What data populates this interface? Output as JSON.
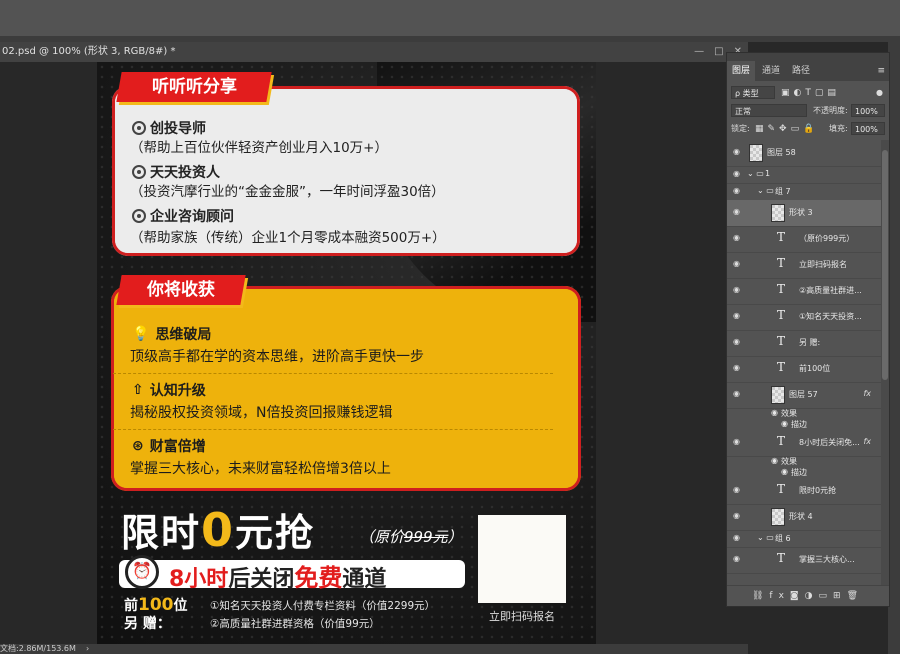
{
  "document": {
    "tab_title": "02.psd @ 100% (形状 3, RGB/8#) *",
    "status": {
      "doc_size": "文档:2.86M/153.6M"
    }
  },
  "poster": {
    "share_tag": "听听听分享",
    "share_items": [
      {
        "title": "创投导师",
        "desc": "（帮助上百位伙伴轻资产创业月入10万+）"
      },
      {
        "title": "天天投资人",
        "desc": "（投资汽摩行业的“金金金服”，一年时间浮盈30倍）"
      },
      {
        "title": "企业咨询顾问",
        "desc": "（帮助家族（传统）企业1个月零成本融资500万+）"
      }
    ],
    "gain_tag": "你将收获",
    "gain_items": [
      {
        "icon": "lightbulb-icon",
        "glyph": "💡",
        "title": "思维破局",
        "desc": "顶级高手都在学的资本思维，进阶高手更快一步"
      },
      {
        "icon": "arrow-up-icon",
        "glyph": "⇧",
        "title": "认知升级",
        "desc": "揭秘股权投资领域，N倍投资回报赚钱逻辑"
      },
      {
        "icon": "money-icon",
        "glyph": "⊛",
        "title": "财富倍增",
        "desc": "掌握三大核心，未来财富轻松倍增3倍以上"
      }
    ],
    "promo": {
      "part1": "限时",
      "zero": "0",
      "part2": "元抢"
    },
    "original_price": {
      "prefix": "（原价",
      "value": "999元",
      "suffix": "）"
    },
    "countdown": {
      "hours": "8小时",
      "middle": "后关闭",
      "free": "免费",
      "end": "通道"
    },
    "first100": {
      "line1_a": "前",
      "line1_num": "100",
      "line1_b": "位",
      "line2": "另    赠："
    },
    "bonuses": [
      "①知名天天投资人付费专栏资料（价值2299元）",
      "②高质量社群进群资格（价值99元）"
    ],
    "qr_label": "立即扫码报名"
  },
  "layers_panel": {
    "tabs": [
      "图层",
      "通道",
      "路径"
    ],
    "filter_kind": "ρ 类型",
    "blend_mode": "正常",
    "opacity_label": "不透明度:",
    "opacity": "100%",
    "lock_label": "锁定:",
    "fill_label": "填充:",
    "fill": "100%",
    "layers": [
      {
        "name": "图层 58",
        "kind": "image",
        "indent": 0
      },
      {
        "name": "1",
        "kind": "group",
        "indent": 0
      },
      {
        "name": "组 7",
        "kind": "group",
        "indent": 1
      },
      {
        "name": "形状 3",
        "kind": "shape",
        "indent": 2,
        "selected": true
      },
      {
        "name": "（原价999元）",
        "kind": "text",
        "indent": 2
      },
      {
        "name": "立即扫码报名",
        "kind": "text",
        "indent": 2
      },
      {
        "name": "②高质量社群进...",
        "kind": "text",
        "indent": 2
      },
      {
        "name": "①知名天天投资...",
        "kind": "text",
        "indent": 2
      },
      {
        "name": "另    赠:",
        "kind": "text",
        "indent": 2
      },
      {
        "name": "前100位",
        "kind": "text",
        "indent": 2
      },
      {
        "name": "图层 57",
        "kind": "image",
        "indent": 2,
        "fx": true
      },
      {
        "name": "效果",
        "kind": "effect",
        "indent": 3
      },
      {
        "name": "描边",
        "kind": "effect",
        "indent": 4
      },
      {
        "name": "8小时后关闭免...",
        "kind": "text",
        "indent": 2,
        "fx": true
      },
      {
        "name": "效果",
        "kind": "effect",
        "indent": 3
      },
      {
        "name": "描边",
        "kind": "effect",
        "indent": 4
      },
      {
        "name": "限时0元抢",
        "kind": "text",
        "indent": 2
      },
      {
        "name": "形状 4",
        "kind": "shape",
        "indent": 2
      },
      {
        "name": "组 6",
        "kind": "group",
        "indent": 1
      },
      {
        "name": "掌握三大核心...",
        "kind": "text",
        "indent": 2
      }
    ],
    "fx_label": "fx"
  }
}
